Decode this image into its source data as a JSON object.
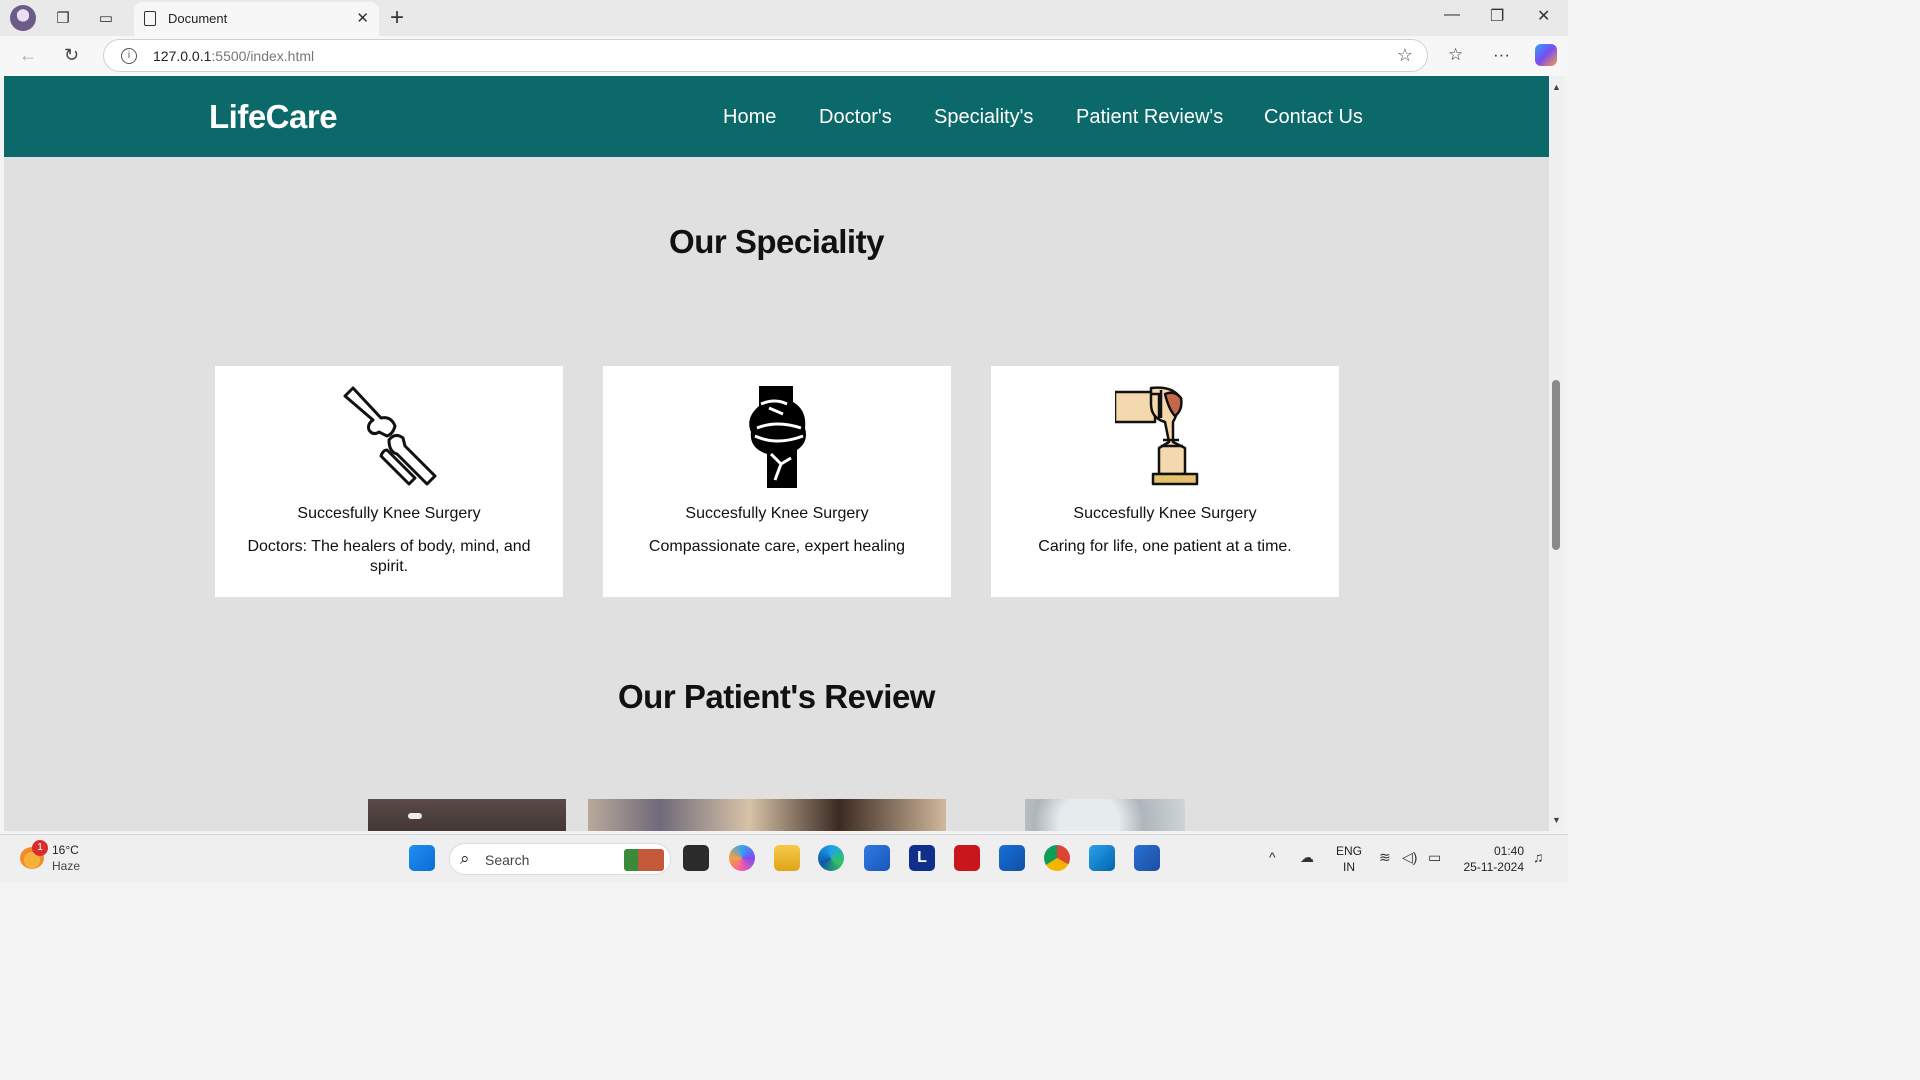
{
  "browser": {
    "tab_title": "Document",
    "url_host": "127.0.0.1",
    "url_rest": ":5500/index.html"
  },
  "site": {
    "brand": "LifeCare",
    "nav": [
      "Home",
      "Doctor's",
      "Speciality's",
      "Patient Review's",
      "Contact Us"
    ]
  },
  "speciality": {
    "title": "Our Speciality",
    "cards": [
      {
        "icon": "bone-joint-outline-icon",
        "heading": "Succesfully Knee Surgery",
        "text": "Doctors: The healers of body, mind, and spirit."
      },
      {
        "icon": "knee-joint-solid-icon",
        "heading": "Succesfully Knee Surgery",
        "text": "Compassionate care, expert healing"
      },
      {
        "icon": "knee-treatment-icon",
        "heading": "Succesfully Knee Surgery",
        "text": "Caring for life, one patient at a time."
      }
    ]
  },
  "reviews": {
    "title": "Our Patient's Review"
  },
  "taskbar": {
    "weather_badge": "1",
    "temperature": "16°C",
    "condition": "Haze",
    "search_label": "Search",
    "lang_line1": "ENG",
    "lang_line2": "IN",
    "time": "01:40",
    "date": "25-11-2024"
  }
}
